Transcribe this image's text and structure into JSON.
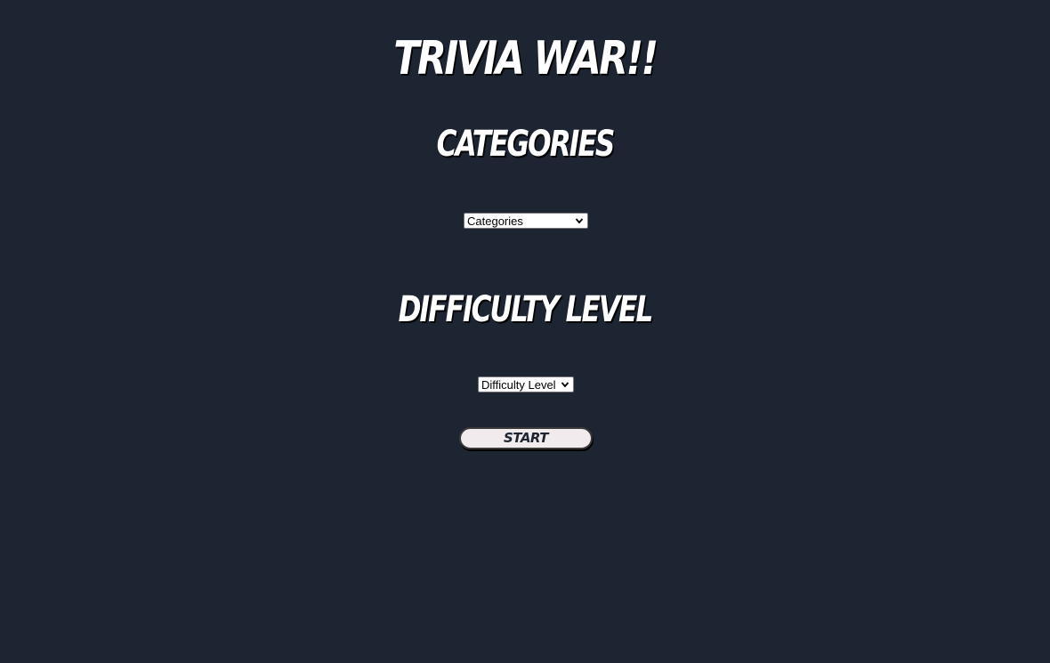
{
  "app": {
    "title": "TRIVIA WAR!!"
  },
  "categories": {
    "heading": "CATEGORIES",
    "selected": "Categories"
  },
  "difficulty": {
    "heading": "DIFFICULTY LEVEL",
    "selected": "Difficulty Level"
  },
  "actions": {
    "start_label": "START"
  },
  "icons": {
    "select_arrow": "chevron-down-icon"
  },
  "colors": {
    "background": "#1d2432",
    "heading_text": "#ffffff",
    "button_background": "#f1ebee",
    "button_text": "#1d2432"
  }
}
